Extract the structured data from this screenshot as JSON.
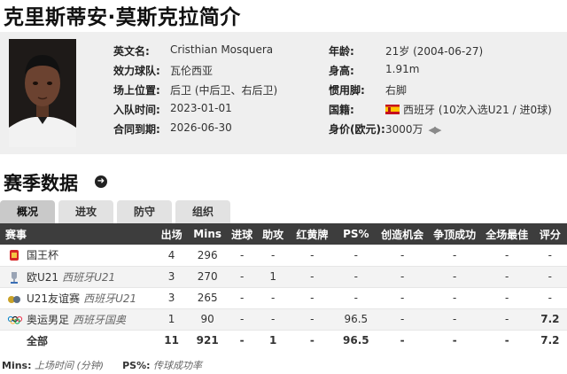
{
  "player": {
    "name_cn": "克里斯蒂安·莫斯克拉简介",
    "fields_left": [
      {
        "label": "英文名:",
        "value": "Cristhian Mosquera"
      },
      {
        "label": "效力球队:",
        "value": "瓦伦西亚"
      },
      {
        "label": "场上位置:",
        "value": "后卫 (中后卫、右后卫)"
      },
      {
        "label": "入队时间:",
        "value": "2023-01-01"
      },
      {
        "label": "合同到期:",
        "value": "2026-06-30"
      }
    ],
    "fields_right": [
      {
        "label": "年龄:",
        "value": "21岁 (2004-06-27)"
      },
      {
        "label": "身高:",
        "value": "1.91m"
      },
      {
        "label": "惯用脚:",
        "value": "右脚"
      },
      {
        "label": "国籍:",
        "value": "西班牙 (10次入选U21 / 进0球)"
      },
      {
        "label": "身价(欧元):",
        "value": "3000万"
      }
    ]
  },
  "season": {
    "title": "赛季数据",
    "tabs": [
      "概况",
      "进攻",
      "防守",
      "组织"
    ],
    "active_tab": 0,
    "columns": [
      "赛事",
      "出场",
      "Mins",
      "进球",
      "助攻",
      "红黄牌",
      "PS%",
      "创造机会",
      "争顶成功",
      "全场最佳",
      "评分"
    ],
    "rows": [
      {
        "comp": "国王杯",
        "team": "",
        "icon": "copa-del-rey-icon",
        "apps": "4",
        "mins": "296",
        "goals": "-",
        "assists": "-",
        "cards": "-",
        "ps": "-",
        "chances": "-",
        "aerials": "-",
        "motm": "-",
        "rating": "-"
      },
      {
        "comp": "欧U21",
        "team": "西班牙U21",
        "icon": "uefa-u21-icon",
        "apps": "3",
        "mins": "270",
        "goals": "-",
        "assists": "1",
        "cards": "-",
        "ps": "-",
        "chances": "-",
        "aerials": "-",
        "motm": "-",
        "rating": "-"
      },
      {
        "comp": "U21友谊赛",
        "team": "西班牙U21",
        "icon": "friendly-icon",
        "apps": "3",
        "mins": "265",
        "goals": "-",
        "assists": "-",
        "cards": "-",
        "ps": "-",
        "chances": "-",
        "aerials": "-",
        "motm": "-",
        "rating": "-"
      },
      {
        "comp": "奥运男足",
        "team": "西班牙国奥",
        "icon": "olympic-rings-icon",
        "apps": "1",
        "mins": "90",
        "goals": "-",
        "assists": "-",
        "cards": "-",
        "ps": "96.5",
        "chances": "-",
        "aerials": "-",
        "motm": "-",
        "rating": "7.2"
      }
    ],
    "total": {
      "label": "全部",
      "apps": "11",
      "mins": "921",
      "goals": "-",
      "assists": "1",
      "cards": "-",
      "ps": "96.5",
      "chances": "-",
      "aerials": "-",
      "motm": "-",
      "rating": "7.2"
    }
  },
  "footnote": {
    "mins_key": "Mins:",
    "mins_desc": "上场时间 (分钟)",
    "ps_key": "PS%:",
    "ps_desc": "传球成功率"
  },
  "colors": {
    "header_bg": "#3d3d3d",
    "rating": "#ff7a00",
    "profile_bg": "#efefef"
  }
}
